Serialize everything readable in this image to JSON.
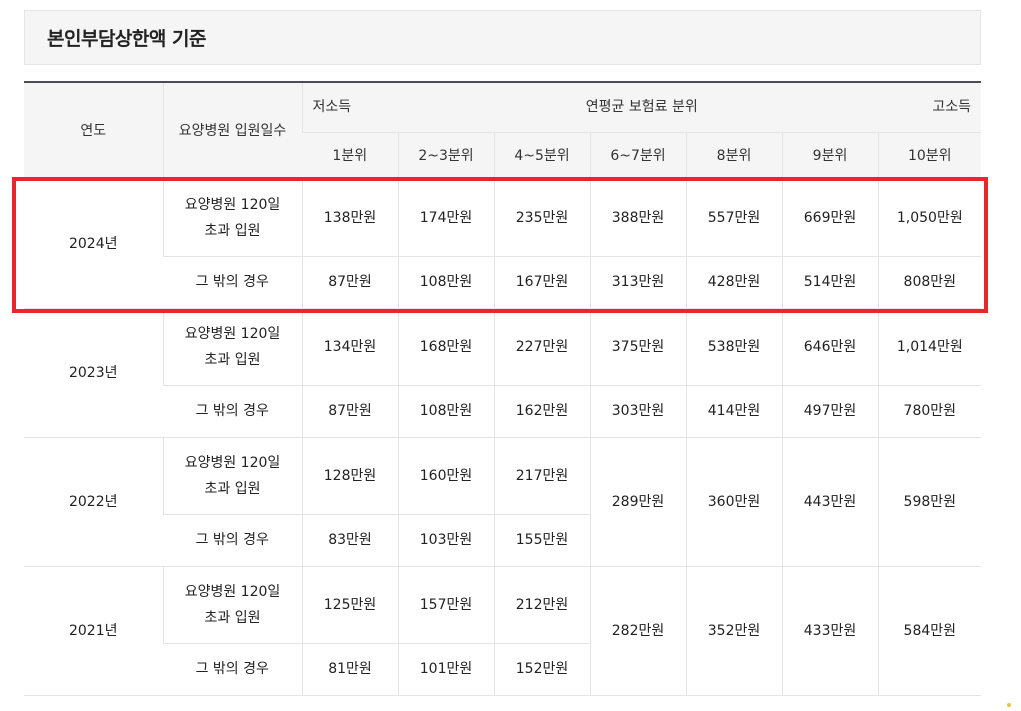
{
  "title": "본인부담상한액 기준",
  "header": {
    "year": "연도",
    "stay": "요양병원 입원일수",
    "low": "저소득",
    "mid": "연평균 보험료 분위",
    "high": "고소득",
    "deciles": [
      "1분위",
      "2~3분위",
      "4~5분위",
      "6~7분위",
      "8분위",
      "9분위",
      "10분위"
    ]
  },
  "stay_labels": {
    "over_line1": "요양병원 120일",
    "over_line2": "초과 입원",
    "other": "그 밖의 경우"
  },
  "rows": [
    {
      "year": "2024년",
      "over": [
        "138만원",
        "174만원",
        "235만원",
        "388만원",
        "557만원",
        "669만원",
        "1,050만원"
      ],
      "other": [
        "87만원",
        "108만원",
        "167만원",
        "313만원",
        "428만원",
        "514만원",
        "808만원"
      ]
    },
    {
      "year": "2023년",
      "over": [
        "134만원",
        "168만원",
        "227만원",
        "375만원",
        "538만원",
        "646만원",
        "1,014만원"
      ],
      "other": [
        "87만원",
        "108만원",
        "162만원",
        "303만원",
        "414만원",
        "497만원",
        "780만원"
      ]
    },
    {
      "year": "2022년",
      "over": [
        "128만원",
        "160만원",
        "217만원"
      ],
      "other": [
        "83만원",
        "103만원",
        "155만원"
      ],
      "shared": [
        "289만원",
        "360만원",
        "443만원",
        "598만원"
      ]
    },
    {
      "year": "2021년",
      "over": [
        "125만원",
        "157만원",
        "212만원"
      ],
      "other": [
        "81만원",
        "101만원",
        "152만원"
      ],
      "shared": [
        "282만원",
        "352만원",
        "433만원",
        "584만원"
      ]
    }
  ],
  "colors": {
    "highlight": "#e8262b",
    "header_bg": "#f5f5f5",
    "top_rule": "#4a4a5a"
  }
}
